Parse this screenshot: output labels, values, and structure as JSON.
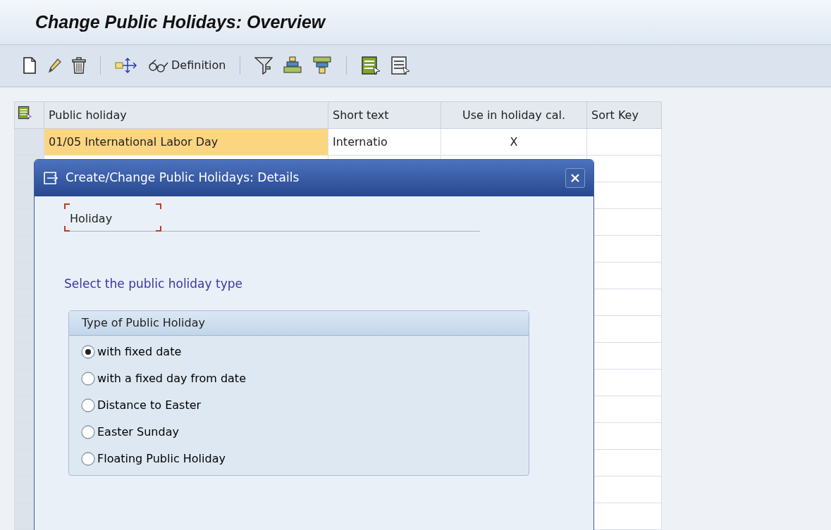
{
  "window": {
    "title": "Change Public Holidays: Overview"
  },
  "toolbar": {
    "definition_label": "Definition"
  },
  "table": {
    "columns": [
      "Public holiday",
      "Short text",
      "Use in holiday cal.",
      "Sort Key"
    ],
    "rows": [
      {
        "cells": [
          {
            "text": "01/05 International Labor Day",
            "selected": true
          },
          {
            "text": "Internatio",
            "selected": false
          },
          {
            "text": "X",
            "selected": false
          }
        ]
      }
    ]
  },
  "dialog": {
    "title": "Create/Change Public Holidays: Details",
    "section_label": "Holiday",
    "prompt": "Select the public holiday type",
    "group": {
      "title": "Type of Public Holiday",
      "options": [
        {
          "label": "with fixed date",
          "selected": true
        },
        {
          "label": "with a fixed day from date",
          "selected": false
        },
        {
          "label": "Distance to Easter",
          "selected": false
        },
        {
          "label": "Easter Sunday",
          "selected": false
        },
        {
          "label": "Floating Public Holiday",
          "selected": false
        }
      ]
    }
  }
}
